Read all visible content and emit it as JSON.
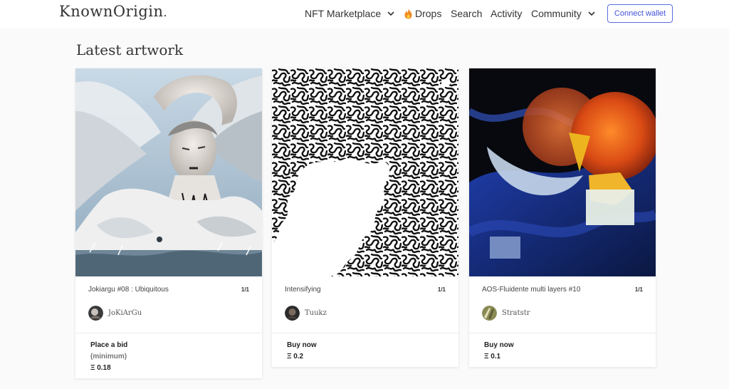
{
  "header": {
    "logo": "KnownOrigin",
    "logo_dot": ".",
    "nav": {
      "marketplace": "NFT Marketplace",
      "drops": "Drops",
      "search": "Search",
      "activity": "Activity",
      "community": "Community"
    },
    "connect_wallet": "Connect wallet"
  },
  "section": {
    "title": "Latest artwork"
  },
  "cards": [
    {
      "title": "Jokiargu #08 : Ubiquitous",
      "edition": "1/1",
      "artist": "JoKiArGu",
      "action": "Place a bid",
      "action_sub": "(minimum)",
      "price": "Ξ 0.18"
    },
    {
      "title": "Intensifying",
      "edition": "1/1",
      "artist": "Tuukz",
      "action": "Buy now",
      "price": "Ξ 0.2"
    },
    {
      "title": "AOS-Fluidente multi layers #10",
      "edition": "1/1",
      "artist": "Stratstr",
      "action": "Buy now",
      "price": "Ξ 0.1"
    }
  ],
  "colors": {
    "accent": "#3f51d4",
    "flame": "#f08a24",
    "background": "#fafafa"
  },
  "icons": [
    "flame-icon",
    "chevron-down-icon"
  ]
}
